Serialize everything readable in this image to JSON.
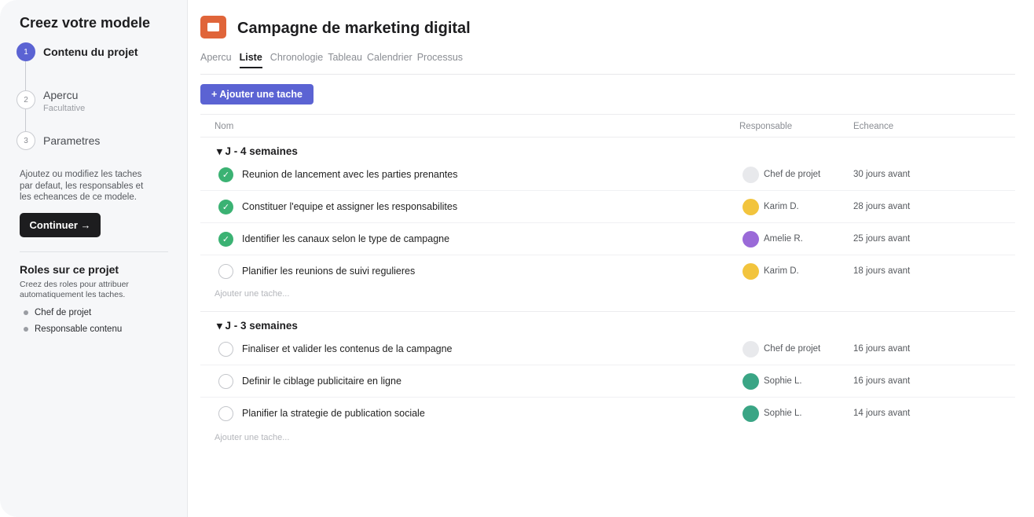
{
  "sidebar": {
    "title": "Creez votre modele",
    "steps": [
      {
        "number": "1",
        "label": "Contenu du projet",
        "sub": "",
        "state": "active"
      },
      {
        "number": "2",
        "label": "Apercu",
        "sub": "Facultative",
        "state": "idle"
      },
      {
        "number": "3",
        "label": "Parametres",
        "sub": "",
        "state": "idle"
      }
    ],
    "description": "Ajoutez ou modifiez les taches par defaut, les responsables et les echeances de ce modele.",
    "continue_label": "Continuer →",
    "roles_title": "Roles sur ce projet",
    "roles_description": "Creez des roles pour attribuer automatiquement les taches.",
    "roles": [
      "Chef de projet",
      "Responsable contenu"
    ]
  },
  "project": {
    "title": "Campagne de marketing digital",
    "icon": "presentation-icon",
    "icon_color": "#e0653a"
  },
  "tabs": [
    {
      "label": "Apercu",
      "active": false
    },
    {
      "label": "Liste",
      "active": true
    },
    {
      "label": "Chronologie",
      "active": false
    },
    {
      "label": "Tableau",
      "active": false
    },
    {
      "label": "Calendrier",
      "active": false
    },
    {
      "label": "Processus",
      "active": false
    }
  ],
  "add_task_button": "+ Ajouter une tache",
  "table": {
    "columns": {
      "name": "Nom",
      "owner": "Responsable",
      "due": "Echeance"
    },
    "sections": [
      {
        "title": "▾ J - 4 semaines",
        "add_placeholder": "Ajouter une tache...",
        "tasks": [
          {
            "name": "Reunion de lancement avec les parties prenantes",
            "done": true,
            "owner": "Chef de projet",
            "avatar_color": "#e8e9ec",
            "due": "30 jours avant"
          },
          {
            "name": "Constituer l'equipe et assigner les responsabilites",
            "done": true,
            "owner": "Karim D.",
            "avatar_color": "#f2c43d",
            "due": "28 jours avant"
          },
          {
            "name": "Identifier les canaux selon le type de campagne",
            "done": true,
            "owner": "Amelie R.",
            "avatar_color": "#9a6ad8",
            "due": "25 jours avant"
          },
          {
            "name": "Planifier les reunions de suivi regulieres",
            "done": false,
            "owner": "Karim D.",
            "avatar_color": "#f2c43d",
            "due": "18 jours avant"
          }
        ]
      },
      {
        "title": "▾ J - 3 semaines",
        "add_placeholder": "Ajouter une tache...",
        "tasks": [
          {
            "name": "Finaliser et valider les contenus de la campagne",
            "done": false,
            "owner": "Chef de projet",
            "avatar_color": "#e8e9ec",
            "due": "16 jours avant"
          },
          {
            "name": "Definir le ciblage publicitaire en ligne",
            "done": false,
            "owner": "Sophie L.",
            "avatar_color": "#3aa585",
            "due": "16 jours avant"
          },
          {
            "name": "Planifier la strategie de publication sociale",
            "done": false,
            "owner": "Sophie L.",
            "avatar_color": "#3aa585",
            "due": "14 jours avant"
          }
        ]
      }
    ]
  },
  "colors": {
    "accent": "#5b63d3",
    "done": "#3bb273",
    "dark": "#1d1d1f"
  }
}
